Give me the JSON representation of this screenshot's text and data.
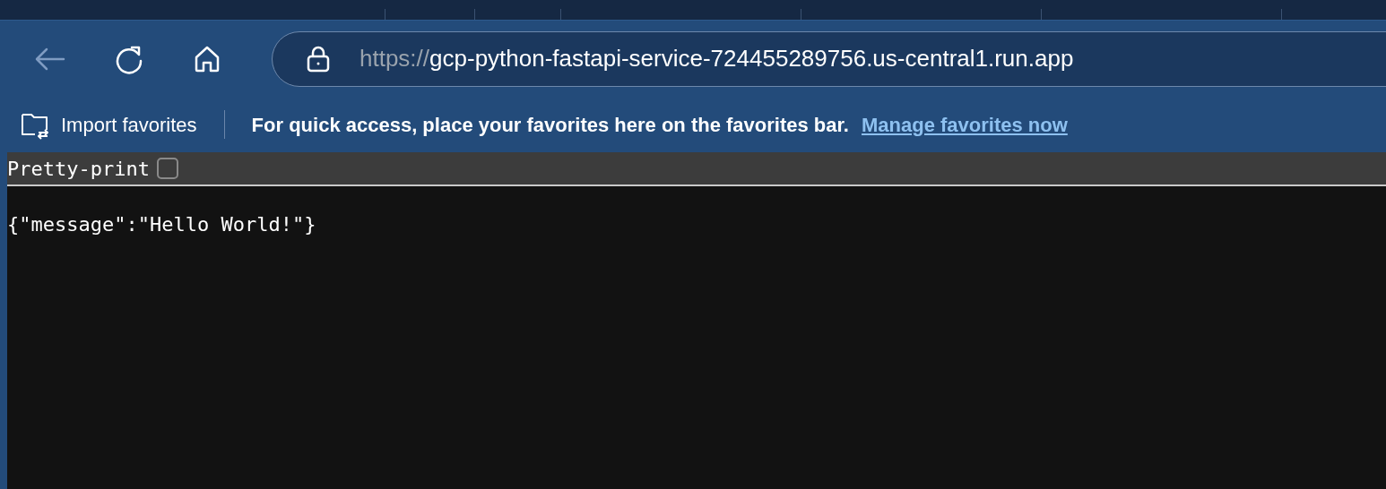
{
  "address_bar": {
    "url_scheme": "https://",
    "url_rest": "gcp-python-fastapi-service-724455289756.us-central1.run.app"
  },
  "favorites_bar": {
    "import_button": "Import favorites",
    "hint": "For quick access, place your favorites here on the favorites bar.",
    "link": "Manage favorites now"
  },
  "json_viewer": {
    "pretty_print": {
      "label": "Pretty-print",
      "checked": false
    },
    "body": "{\"message\":\"Hello World!\"}"
  }
}
